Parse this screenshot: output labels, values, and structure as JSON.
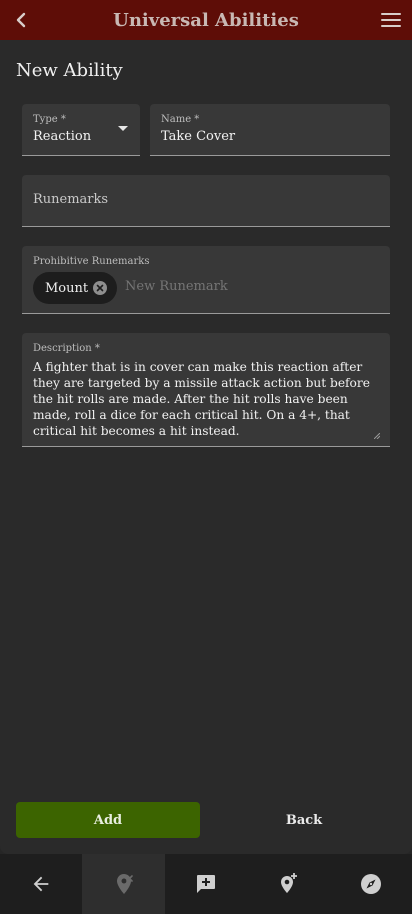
{
  "header": {
    "title": "Universal Abilities"
  },
  "page": {
    "title": "New Ability"
  },
  "form": {
    "type": {
      "label": "Type *",
      "value": "Reaction"
    },
    "name": {
      "label": "Name *",
      "value": "Take Cover"
    },
    "runemarks": {
      "placeholder": "Runemarks"
    },
    "prohibitive_runemarks": {
      "label": "Prohibitive Runemarks",
      "chips": [
        "Mount"
      ],
      "input_placeholder": "New Runemark"
    },
    "description": {
      "label": "Description *",
      "value": "A fighter that is in cover can make this reaction after they are targeted by a missile attack action but before the hit rolls are made. After the hit rolls have been made, roll a dice for each critical hit. On a 4+, that critical hit becomes a hit instead."
    }
  },
  "actions": {
    "add_label": "Add",
    "back_label": "Back"
  },
  "bottom_nav": {
    "items": [
      "back-arrow-icon",
      "location-off-icon",
      "add-comment-icon",
      "add-location-icon",
      "compass-icon"
    ],
    "active_index": 1
  },
  "colors": {
    "header_bg": "#5e0d07",
    "add_button_bg": "#3c6400",
    "panel_bg": "#2a2a2a",
    "field_bg": "#383838"
  }
}
